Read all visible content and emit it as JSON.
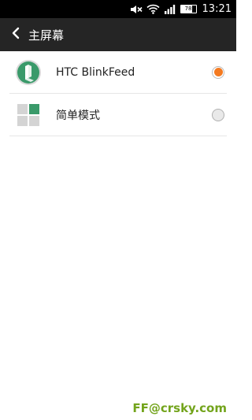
{
  "status_bar": {
    "time": "13:21",
    "battery_level": "78",
    "icons": [
      "mute-icon",
      "wifi-icon",
      "signal-icon",
      "battery-icon"
    ]
  },
  "app_bar": {
    "title": "主屏幕",
    "back_icon": "chevron-left-icon"
  },
  "options": [
    {
      "label": "HTC BlinkFeed",
      "icon": "blinkfeed-icon",
      "selected": true
    },
    {
      "label": "简单模式",
      "icon": "simple-mode-grid-icon",
      "selected": false
    }
  ],
  "watermark": "FF@crsky.com",
  "colors": {
    "status_bar_bg": "#000000",
    "app_bar_bg": "#252525",
    "accent_orange": "#f47a20",
    "blinkfeed_green": "#3a9a6a",
    "watermark_green": "#73a41c"
  }
}
